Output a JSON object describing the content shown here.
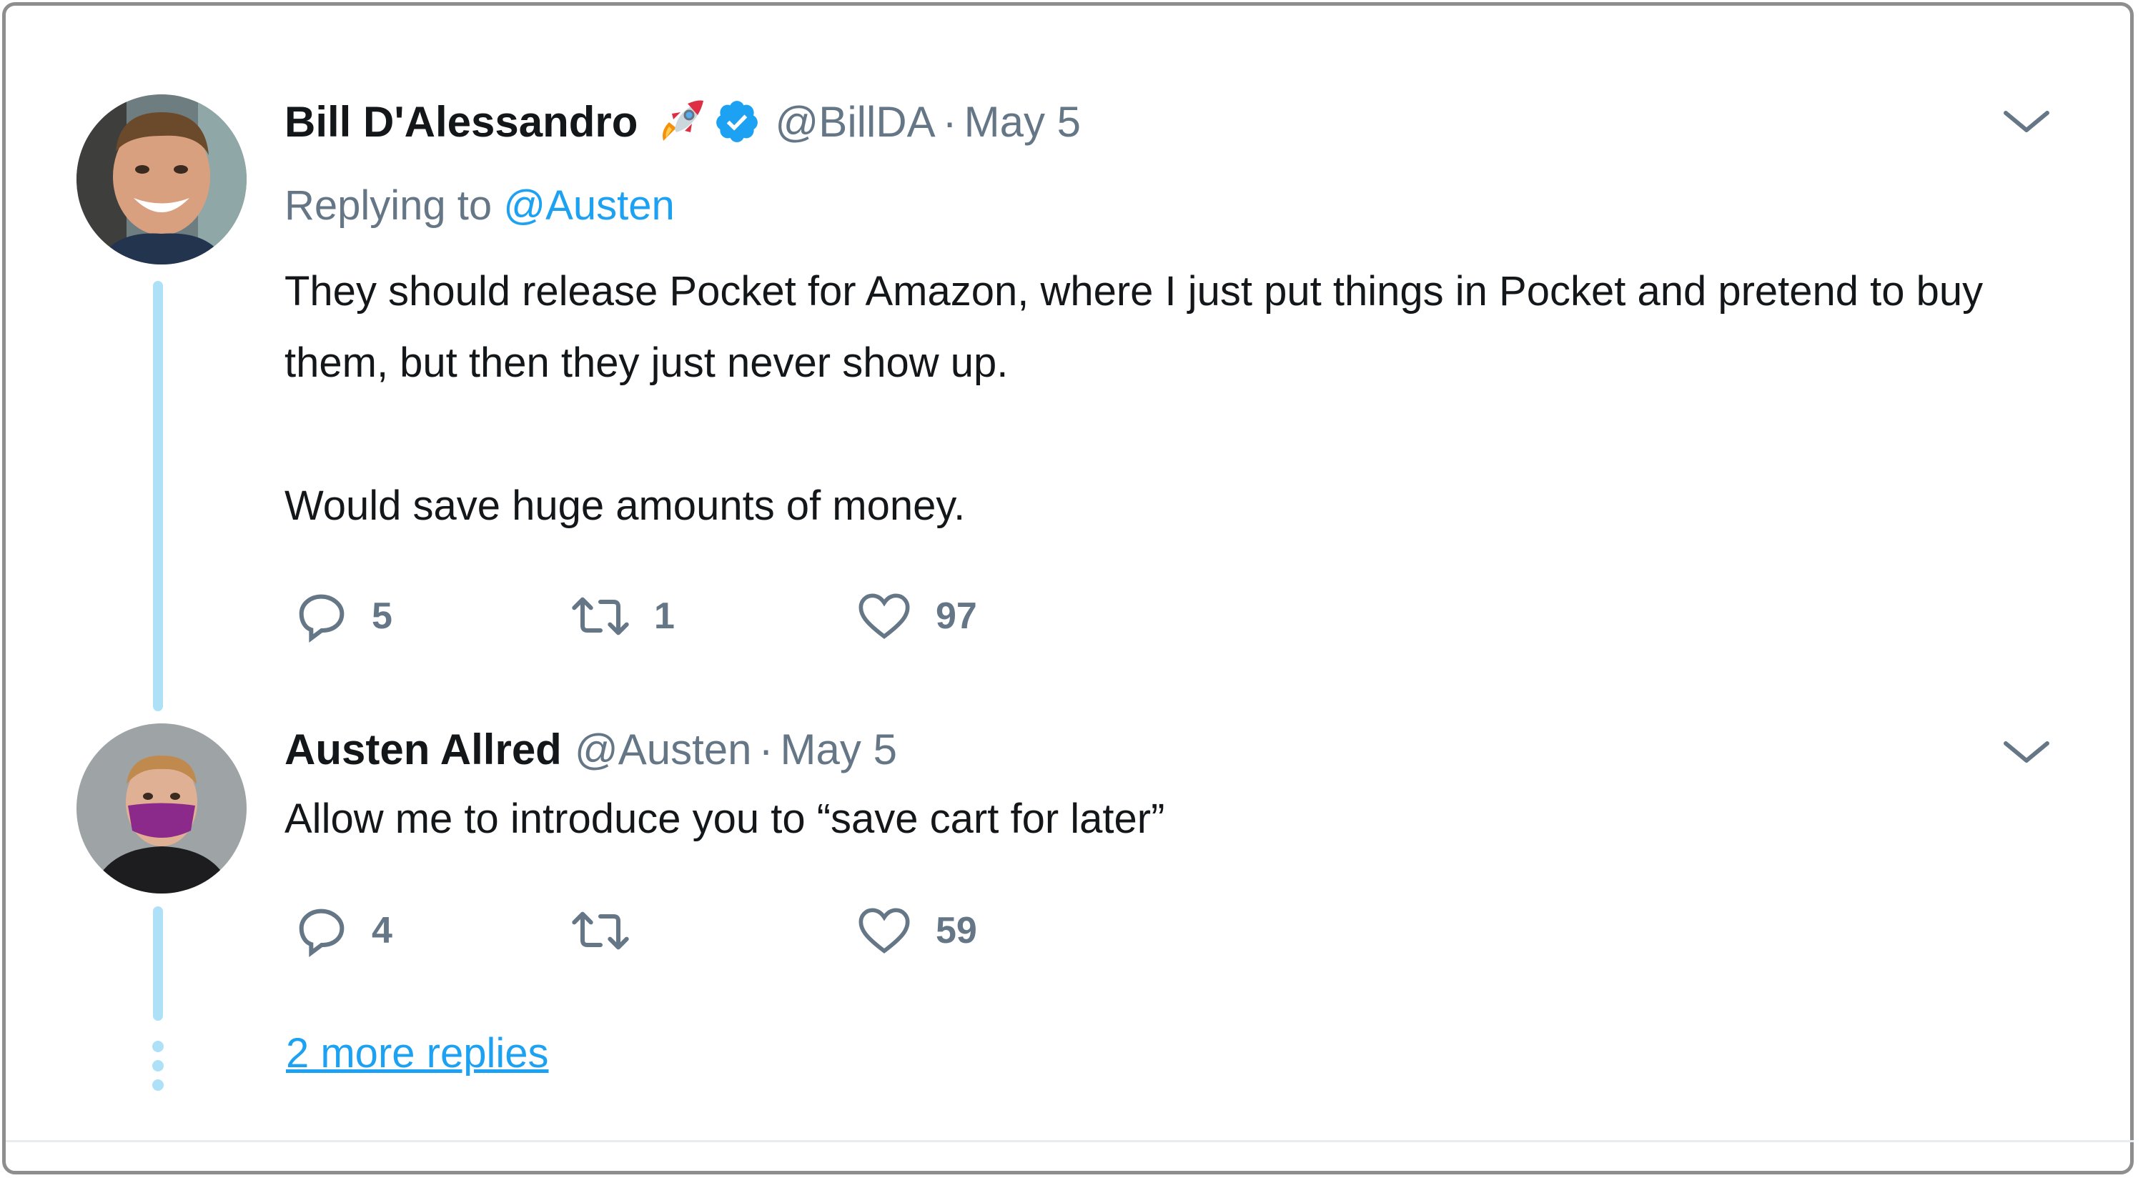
{
  "tweets": [
    {
      "name": "Bill D'Alessandro",
      "name_emoji": "rocket-emoji",
      "verified": true,
      "handle": "@BillDA",
      "separator": "·",
      "date": "May 5",
      "replying_prefix": "Replying to",
      "replying_to": "@Austen",
      "text_lines": [
        "They should release Pocket for Amazon, where I just put things in Pocket and pretend to buy",
        "them, but then they just never show up.",
        "Would save huge amounts of money."
      ],
      "replies": "5",
      "retweets": "1",
      "likes": "97"
    },
    {
      "name": "Austen Allred",
      "handle": "@Austen",
      "separator": "·",
      "date": "May 5",
      "text_lines": [
        "Allow me to introduce you to “save cart for later”"
      ],
      "replies": "4",
      "retweets": "",
      "likes": "59"
    }
  ],
  "more_replies_label": "2 more replies",
  "colors": {
    "accent": "#1da1f2",
    "secondary_text": "#657786",
    "primary_text": "#14171a",
    "thread_line": "#aee1f7"
  }
}
